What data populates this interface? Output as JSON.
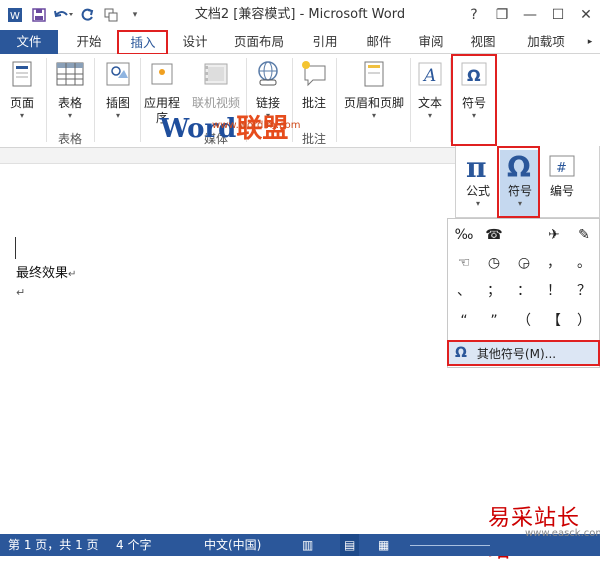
{
  "window": {
    "title": "文档2 [兼容模式] - Microsoft Word",
    "help": "?",
    "restore": "❐",
    "minimize": "—",
    "maximize": "☐",
    "close": "✕"
  },
  "tabs": [
    {
      "label": "文件"
    },
    {
      "label": "开始"
    },
    {
      "label": "插入"
    },
    {
      "label": "设计"
    },
    {
      "label": "页面布局"
    },
    {
      "label": "引用"
    },
    {
      "label": "邮件"
    },
    {
      "label": "审阅"
    },
    {
      "label": "视图"
    },
    {
      "label": "加载项"
    }
  ],
  "ribbon": {
    "pages": "页面",
    "table": "表格",
    "table_group": "表格",
    "illustrations": "插图",
    "apps_line1": "应用程",
    "apps_line2": "序",
    "media": "联机视频",
    "media_group": "媒体",
    "link": "链接",
    "comment": "批注",
    "comment_group": "批注",
    "headerfooter": "页眉和页脚",
    "text": "文本",
    "symbols": "符号"
  },
  "popup": {
    "equation": "公式",
    "symbol": "符号",
    "number": "编号"
  },
  "symbols": [
    [
      "‰",
      "☎",
      "",
      "✈",
      "✎"
    ],
    [
      "☜",
      "◷",
      "◶",
      "，",
      "。"
    ],
    [
      "、",
      "；",
      "：",
      "！",
      "？"
    ],
    [
      "“",
      "”",
      "（",
      "【",
      "）"
    ]
  ],
  "more_symbols": "其他符号(M)...",
  "document": {
    "line1": "最终效果",
    "mark": "↵"
  },
  "status": {
    "page": "第 1 页，共 1 页",
    "words": "4 个字",
    "lang": "中文(中国)"
  },
  "watermark": {
    "word": "Word",
    "lianmeng": "联盟",
    "url": "www.wordlm.com"
  },
  "corner": {
    "text": "易采站长站",
    "url": "www.easck.com"
  }
}
